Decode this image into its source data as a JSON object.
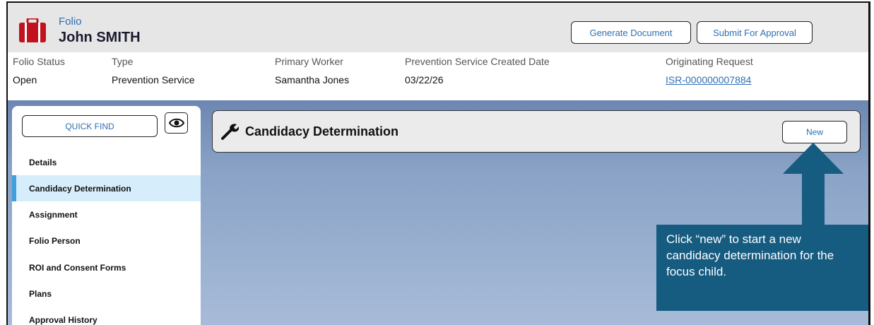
{
  "header": {
    "folio_label": "Folio",
    "person_name": "John SMITH",
    "buttons": {
      "generate": "Generate Document",
      "submit": "Submit For Approval"
    }
  },
  "info": [
    {
      "label": "Folio Status",
      "value": "Open"
    },
    {
      "label": "Type",
      "value": "Prevention Service"
    },
    {
      "label": "Primary Worker",
      "value": "Samantha Jones"
    },
    {
      "label": "Prevention Service Created Date",
      "value": "03/22/26"
    },
    {
      "label": "Originating Request",
      "value": "ISR-000000007884"
    }
  ],
  "sidebar": {
    "quick_find": "QUICK FIND",
    "items": [
      {
        "label": "Details"
      },
      {
        "label": "Candidacy Determination"
      },
      {
        "label": "Assignment"
      },
      {
        "label": "Folio Person"
      },
      {
        "label": "ROI and Consent Forms"
      },
      {
        "label": "Plans"
      },
      {
        "label": "Approval History"
      }
    ]
  },
  "main": {
    "title": "Candidacy Determination",
    "new_button": "New"
  },
  "callout": {
    "text": "Click “new” to start a new candidacy determination for the focus child."
  },
  "colors": {
    "accent": "#2e6fb5",
    "brand_red": "#c1121f",
    "callout_bg": "#165b80",
    "active_nav": "#d6eefb"
  },
  "icons": [
    "briefcase-icon",
    "eye-icon",
    "wrench-icon",
    "arrow-up-icon"
  ]
}
